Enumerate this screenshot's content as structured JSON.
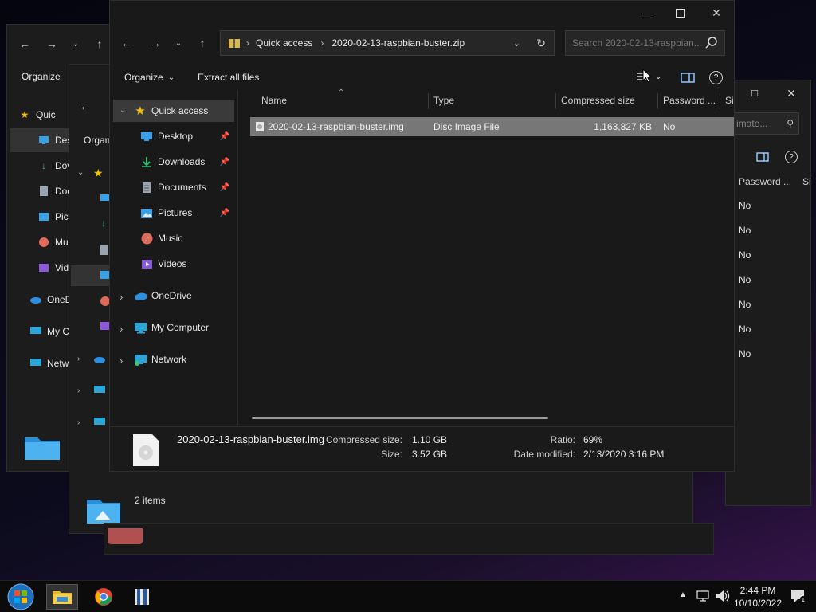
{
  "back_window": {
    "toolbar": {
      "organize": "Organize"
    },
    "nav_truncated": [
      "Quic",
      "Des",
      "Dov",
      "Doc",
      "Pict",
      "Mu",
      "Vid",
      "OneD",
      "My C",
      "Netw"
    ]
  },
  "middle_window": {
    "toolbar": {
      "organize": "Organi"
    },
    "status": {
      "items": "2 items"
    }
  },
  "right_window": {
    "search_placeholder": "imate...",
    "password_header": "Password ...",
    "size_header": "Si",
    "values": [
      "No",
      "No",
      "No",
      "No",
      "No",
      "No",
      "No"
    ]
  },
  "front_window": {
    "breadcrumb": {
      "root": "Quick access",
      "current": "2020-02-13-raspbian-buster.zip"
    },
    "search": {
      "placeholder": "Search 2020-02-13-raspbian..."
    },
    "toolbar": {
      "organize": "Organize",
      "extract_all": "Extract all files"
    },
    "sidebar": {
      "quick_access": "Quick access",
      "items": [
        {
          "label": "Desktop",
          "icon": "desktop-icon",
          "pinned": true
        },
        {
          "label": "Downloads",
          "icon": "download-icon",
          "pinned": true
        },
        {
          "label": "Documents",
          "icon": "document-icon",
          "pinned": true
        },
        {
          "label": "Pictures",
          "icon": "pictures-icon",
          "pinned": true
        },
        {
          "label": "Music",
          "icon": "music-icon",
          "pinned": false
        },
        {
          "label": "Videos",
          "icon": "videos-icon",
          "pinned": false
        }
      ],
      "onedrive": "OneDrive",
      "my_computer": "My Computer",
      "network": "Network"
    },
    "columns": {
      "name": "Name",
      "type": "Type",
      "compressed_size": "Compressed size",
      "password": "Password ...",
      "size": "Si"
    },
    "rows": [
      {
        "name": "2020-02-13-raspbian-buster.img",
        "type": "Disc Image File",
        "compressed_size": "1,163,827 KB",
        "password": "No"
      }
    ],
    "details": {
      "filename": "2020-02-13-raspbian-buster.img",
      "compressed_label": "Compressed size:",
      "compressed_value": "1.10 GB",
      "size_label": "Size:",
      "size_value": "3.52 GB",
      "ratio_label": "Ratio:",
      "ratio_value": "69%",
      "modified_label": "Date modified:",
      "modified_value": "2/13/2020 3:16 PM"
    }
  },
  "taskbar": {
    "time": "2:44 PM",
    "date": "10/10/2022"
  },
  "colors": {
    "selected_row": "#777777",
    "taskbar": "#0b0b0b",
    "window": "#191919"
  }
}
